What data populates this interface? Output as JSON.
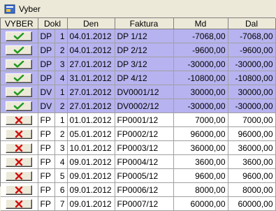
{
  "window": {
    "title": "Vyber"
  },
  "columns": {
    "vyber": "VYBER",
    "dokl": "Dokl",
    "den": "Den",
    "faktura": "Faktura",
    "md": "Md",
    "dal": "Dal"
  },
  "rows": [
    {
      "selected": true,
      "typ": "DP",
      "n": "1",
      "den": "04.01.2012",
      "faktura": "DP 1/12",
      "md": "-7068,00",
      "dal": "-7068,00"
    },
    {
      "selected": true,
      "typ": "DP",
      "n": "2",
      "den": "04.01.2012",
      "faktura": "DP 2/12",
      "md": "-9600,00",
      "dal": "-9600,00"
    },
    {
      "selected": true,
      "typ": "DP",
      "n": "3",
      "den": "27.01.2012",
      "faktura": "DP 3/12",
      "md": "-30000,00",
      "dal": "-30000,00"
    },
    {
      "selected": true,
      "typ": "DP",
      "n": "4",
      "den": "31.01.2012",
      "faktura": "DP 4/12",
      "md": "-10800,00",
      "dal": "-10800,00"
    },
    {
      "selected": true,
      "typ": "DV",
      "n": "1",
      "den": "27.01.2012",
      "faktura": "DV0001/12",
      "md": "30000,00",
      "dal": "30000,00"
    },
    {
      "selected": true,
      "typ": "DV",
      "n": "2",
      "den": "27.01.2012",
      "faktura": "DV0002/12",
      "md": "-30000,00",
      "dal": "-30000,00"
    },
    {
      "selected": false,
      "typ": "FP",
      "n": "1",
      "den": "01.01.2012",
      "faktura": "FP0001/12",
      "md": "7000,00",
      "dal": "7000,00"
    },
    {
      "selected": false,
      "typ": "FP",
      "n": "2",
      "den": "05.01.2012",
      "faktura": "FP0002/12",
      "md": "96000,00",
      "dal": "96000,00"
    },
    {
      "selected": false,
      "typ": "FP",
      "n": "3",
      "den": "10.01.2012",
      "faktura": "FP0003/12",
      "md": "36000,00",
      "dal": "36000,00"
    },
    {
      "selected": false,
      "typ": "FP",
      "n": "4",
      "den": "09.01.2012",
      "faktura": "FP0004/12",
      "md": "3600,00",
      "dal": "3600,00"
    },
    {
      "selected": false,
      "typ": "FP",
      "n": "5",
      "den": "09.01.2012",
      "faktura": "FP0005/12",
      "md": "9600,00",
      "dal": "9600,00"
    },
    {
      "selected": false,
      "typ": "FP",
      "n": "6",
      "den": "09.01.2012",
      "faktura": "FP0006/12",
      "md": "8000,00",
      "dal": "8000,00"
    },
    {
      "selected": false,
      "typ": "FP",
      "n": "7",
      "den": "09.01.2012",
      "faktura": "FP0007/12",
      "md": "60000,00",
      "dal": "60000,00"
    }
  ],
  "colors": {
    "selected_row": "#b7b3f0",
    "check": "#1f9a1f",
    "cross": "#d01010"
  },
  "icons": {
    "app": "app-logo-icon",
    "selected": "checkmark-icon",
    "unselected": "cross-icon"
  }
}
